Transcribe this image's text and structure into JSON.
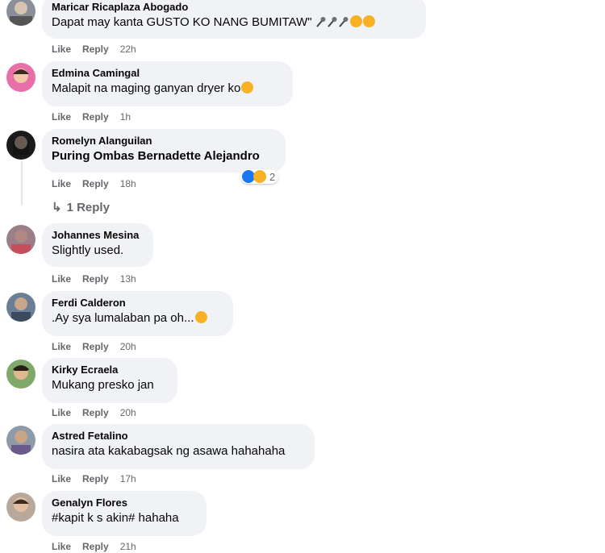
{
  "comments": [
    {
      "author": "Maricar Ricaplaza Abogado",
      "text": "Dapat may kanta GUSTO KO NANG BUMITAW\"",
      "like": "Like",
      "reply": "Reply",
      "time": "22h"
    },
    {
      "author": "Edmina Camingal",
      "text": "Malapit na maging ganyan dryer ko",
      "like": "Like",
      "reply": "Reply",
      "time": "1h"
    },
    {
      "author": "Romelyn Alanguilan",
      "text": "Puring Ombas Bernadette Alejandro",
      "like": "Like",
      "reply": "Reply",
      "time": "18h",
      "reaction_count": "2",
      "replies_label": "1 Reply"
    },
    {
      "author": "Johannes Mesina",
      "text": "Slightly used.",
      "like": "Like",
      "reply": "Reply",
      "time": "13h"
    },
    {
      "author": "Ferdi Calderon",
      "text": ".Ay sya lumalaban pa oh...",
      "like": "Like",
      "reply": "Reply",
      "time": "20h"
    },
    {
      "author": "Kirky Ecraela",
      "text": "Mukang presko jan",
      "like": "Like",
      "reply": "Reply",
      "time": "20h"
    },
    {
      "author": "Astred Fetalino",
      "text": "nasira ata kakabagsak ng asawa hahahaha",
      "like": "Like",
      "reply": "Reply",
      "time": "17h"
    },
    {
      "author": "Genalyn Flores",
      "text": "#kapit k s akin# hahaha",
      "like": "Like",
      "reply": "Reply",
      "time": "21h"
    }
  ],
  "colors": {
    "bubble": "#f0f2f5",
    "secondary_text": "#65676b",
    "like_blue": "#1877f2",
    "laugh_yellow": "#f7b125"
  },
  "icons": [
    "microphone-emoji",
    "rofl-emoji",
    "like-reaction",
    "haha-reaction",
    "reply-arrow-icon",
    "grin-emoji"
  ]
}
